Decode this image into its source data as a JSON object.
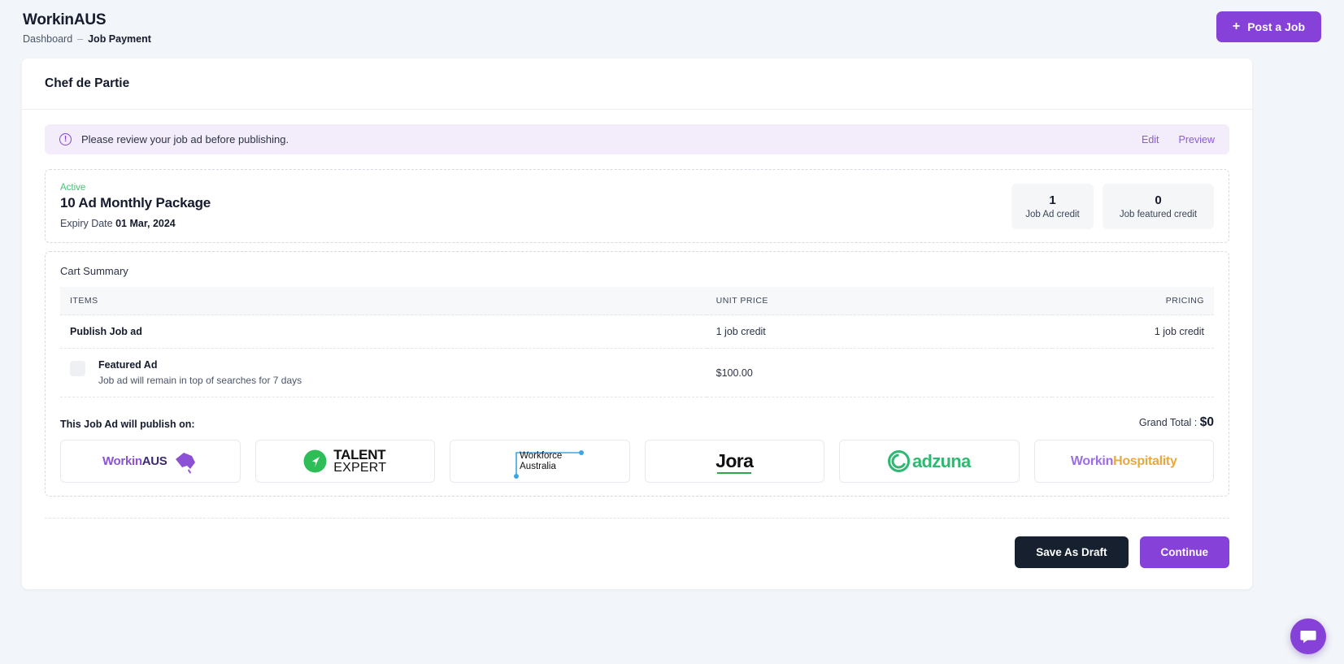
{
  "header": {
    "brand": "WorkinAUS",
    "breadcrumb": {
      "root": "Dashboard",
      "separator": "–",
      "current": "Job Payment"
    },
    "post_job_label": "Post a Job",
    "plus_icon": "plus-icon"
  },
  "page": {
    "title": "Chef de Partie"
  },
  "alert": {
    "icon": "info-circle-icon",
    "message": "Please review your job ad before publishing.",
    "edit_label": "Edit",
    "preview_label": "Preview",
    "accent_color": "#8641d9",
    "background_color": "#f3ecfb"
  },
  "package": {
    "status": "Active",
    "status_color": "#4bc07a",
    "name": "10 Ad Monthly Package",
    "expiry_label": "Expiry Date",
    "expiry_value": "01 Mar, 2024",
    "credits": [
      {
        "value": "1",
        "label": "Job Ad credit"
      },
      {
        "value": "0",
        "label": "Job featured credit"
      }
    ]
  },
  "cart": {
    "title": "Cart Summary",
    "columns": {
      "items": "ITEMS",
      "unit_price": "UNIT PRICE",
      "pricing": "PRICING"
    },
    "rows": [
      {
        "name": "Publish Job ad",
        "description": "",
        "unit_price": "1 job credit",
        "pricing": "1 job credit",
        "has_checkbox": false,
        "checked": false
      },
      {
        "name": "Featured Ad",
        "description": "Job ad will remain in top of searches for 7 days",
        "unit_price": "$100.00",
        "pricing": "",
        "has_checkbox": true,
        "checked": false
      }
    ]
  },
  "publish": {
    "label": "This Job Ad will publish on:",
    "grand_total_label": "Grand Total :",
    "grand_total_value": "$0",
    "logos": [
      {
        "name": "WorkinAUS",
        "id": "workinaus-logo"
      },
      {
        "name": "TALENT EXPERT",
        "id": "talent-expert-logo"
      },
      {
        "name": "Workforce Australia",
        "id": "workforce-australia-logo"
      },
      {
        "name": "Jora",
        "id": "jora-logo"
      },
      {
        "name": "adzuna",
        "id": "adzuna-logo"
      },
      {
        "name": "WorkinHospitality",
        "id": "workinhospitality-logo"
      }
    ],
    "logo_text": {
      "workinaus_a": "Workin",
      "workinaus_b": "AUS",
      "talent_1": "TALENT",
      "talent_2": "EXPERT",
      "wfa_1": "Workforce",
      "wfa_2": "Australia",
      "jora": "Jora",
      "adzuna": "adzuna",
      "hosp_1": "Workin",
      "hosp_2": "Hospitality"
    }
  },
  "footer": {
    "save_draft_label": "Save As Draft",
    "continue_label": "Continue"
  },
  "chat": {
    "icon": "chat-bubble-icon"
  }
}
